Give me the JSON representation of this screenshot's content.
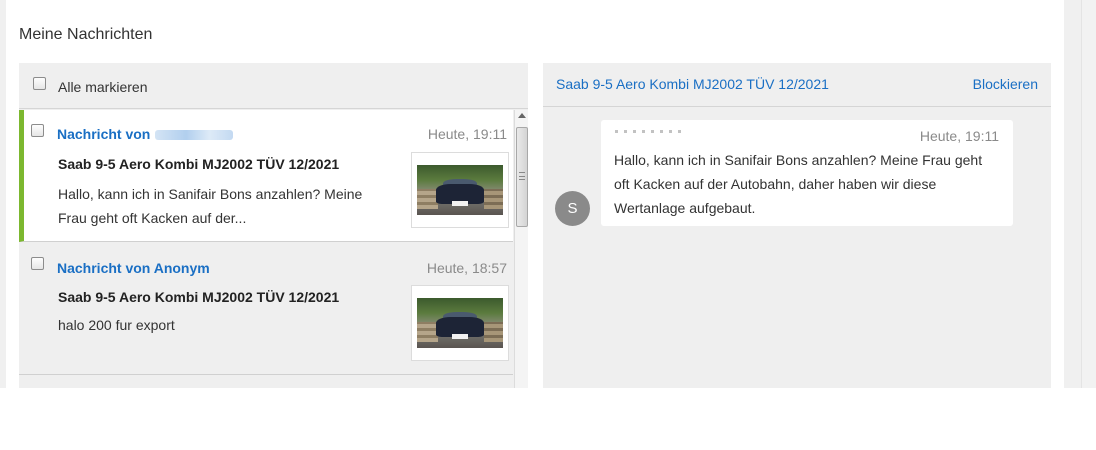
{
  "page": {
    "title": "Meine Nachrichten"
  },
  "list": {
    "select_all_label": "Alle markieren",
    "messages": [
      {
        "sender_prefix": "Nachricht von",
        "sender_name_hidden": true,
        "time": "Heute, 19:11",
        "subject": "Saab 9-5 Aero Kombi MJ2002 TÜV 12/2021",
        "preview": "Hallo, kann ich in Sanifair Bons anzahlen? Meine Frau geht oft Kacken auf der...",
        "active": true
      },
      {
        "sender": "Nachricht von Anonym",
        "time": "Heute, 18:57",
        "subject": "Saab 9-5 Aero Kombi MJ2002 TÜV 12/2021",
        "preview": "halo 200 fur export",
        "active": false
      }
    ]
  },
  "conversation": {
    "title": "Saab 9-5 Aero Kombi MJ2002 TÜV 12/2021",
    "block_label": "Blockieren",
    "messages": [
      {
        "avatar_initial": "S",
        "time": "Heute, 19:11",
        "text": "Hallo, kann ich in Sanifair Bons anzahlen? Meine Frau geht oft Kacken auf der Autobahn, daher haben wir diese Wertanlage aufgebaut."
      }
    ]
  },
  "colors": {
    "link": "#1a6fc4",
    "active_marker": "#7cb82f",
    "avatar": "#8a8a8a"
  }
}
